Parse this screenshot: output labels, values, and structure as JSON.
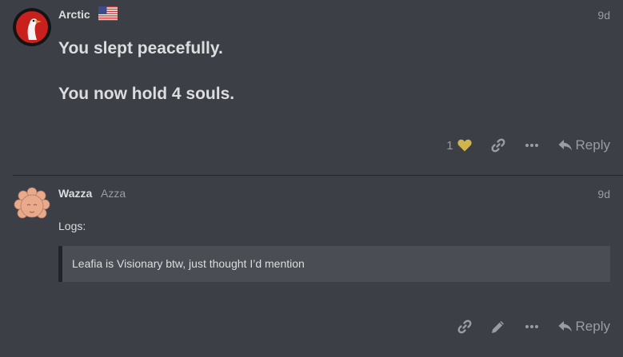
{
  "posts": [
    {
      "username": "Arctic",
      "date": "9d",
      "lines": [
        "You slept peacefully.",
        "You now hold 4 souls."
      ],
      "like_count": "1",
      "reply_label": "Reply"
    },
    {
      "username": "Wazza",
      "user_title": "Azza",
      "date": "9d",
      "intro": "Logs:",
      "quote": "Leafia is Visionary btw, just thought I’d mention",
      "reply_label": "Reply"
    }
  ],
  "colors": {
    "background": "#3c3f45",
    "quote_background": "#4a4d53",
    "heart": "#d1b44c",
    "muted_text": "#9a9ca1"
  },
  "icons": {
    "flag": "us-flag-icon",
    "like": "heart-icon",
    "link": "link-icon",
    "more": "ellipsis-icon",
    "edit": "pencil-icon",
    "reply": "reply-arrow-icon"
  }
}
